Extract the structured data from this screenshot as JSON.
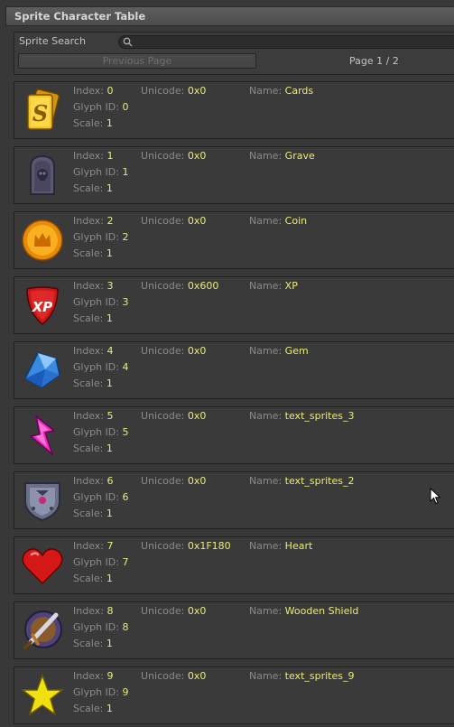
{
  "window": {
    "title": "Sprite Character Table"
  },
  "search": {
    "label": "Sprite Search",
    "value": "",
    "placeholder": ""
  },
  "pagination": {
    "prev_label": "Previous Page",
    "page_label": "Page 1 / 2"
  },
  "labels": {
    "index": "Index:",
    "unicode": "Unicode:",
    "name": "Name:",
    "glyph_id": "Glyph ID:",
    "scale": "Scale:"
  },
  "sprites": [
    {
      "index": "0",
      "unicode": "0x0",
      "name": "Cards",
      "glyph_id": "0",
      "scale": "1",
      "icon": "cards-icon"
    },
    {
      "index": "1",
      "unicode": "0x0",
      "name": "Grave",
      "glyph_id": "1",
      "scale": "1",
      "icon": "gravestone-icon"
    },
    {
      "index": "2",
      "unicode": "0x0",
      "name": "Coin",
      "glyph_id": "2",
      "scale": "1",
      "icon": "coin-icon"
    },
    {
      "index": "3",
      "unicode": "0x600",
      "name": "XP",
      "glyph_id": "3",
      "scale": "1",
      "icon": "xp-shield-icon"
    },
    {
      "index": "4",
      "unicode": "0x0",
      "name": "Gem",
      "glyph_id": "4",
      "scale": "1",
      "icon": "gem-icon"
    },
    {
      "index": "5",
      "unicode": "0x0",
      "name": "text_sprites_3",
      "glyph_id": "5",
      "scale": "1",
      "icon": "lightning-bolt-icon"
    },
    {
      "index": "6",
      "unicode": "0x0",
      "name": "text_sprites_2",
      "glyph_id": "6",
      "scale": "1",
      "icon": "armor-shield-icon"
    },
    {
      "index": "7",
      "unicode": "0x1F180",
      "name": "Heart",
      "glyph_id": "7",
      "scale": "1",
      "icon": "heart-icon"
    },
    {
      "index": "8",
      "unicode": "0x0",
      "name": "Wooden Shield",
      "glyph_id": "8",
      "scale": "1",
      "icon": "sword-shield-icon"
    },
    {
      "index": "9",
      "unicode": "0x0",
      "name": "text_sprites_9",
      "glyph_id": "9",
      "scale": "1",
      "icon": "star-icon"
    }
  ]
}
